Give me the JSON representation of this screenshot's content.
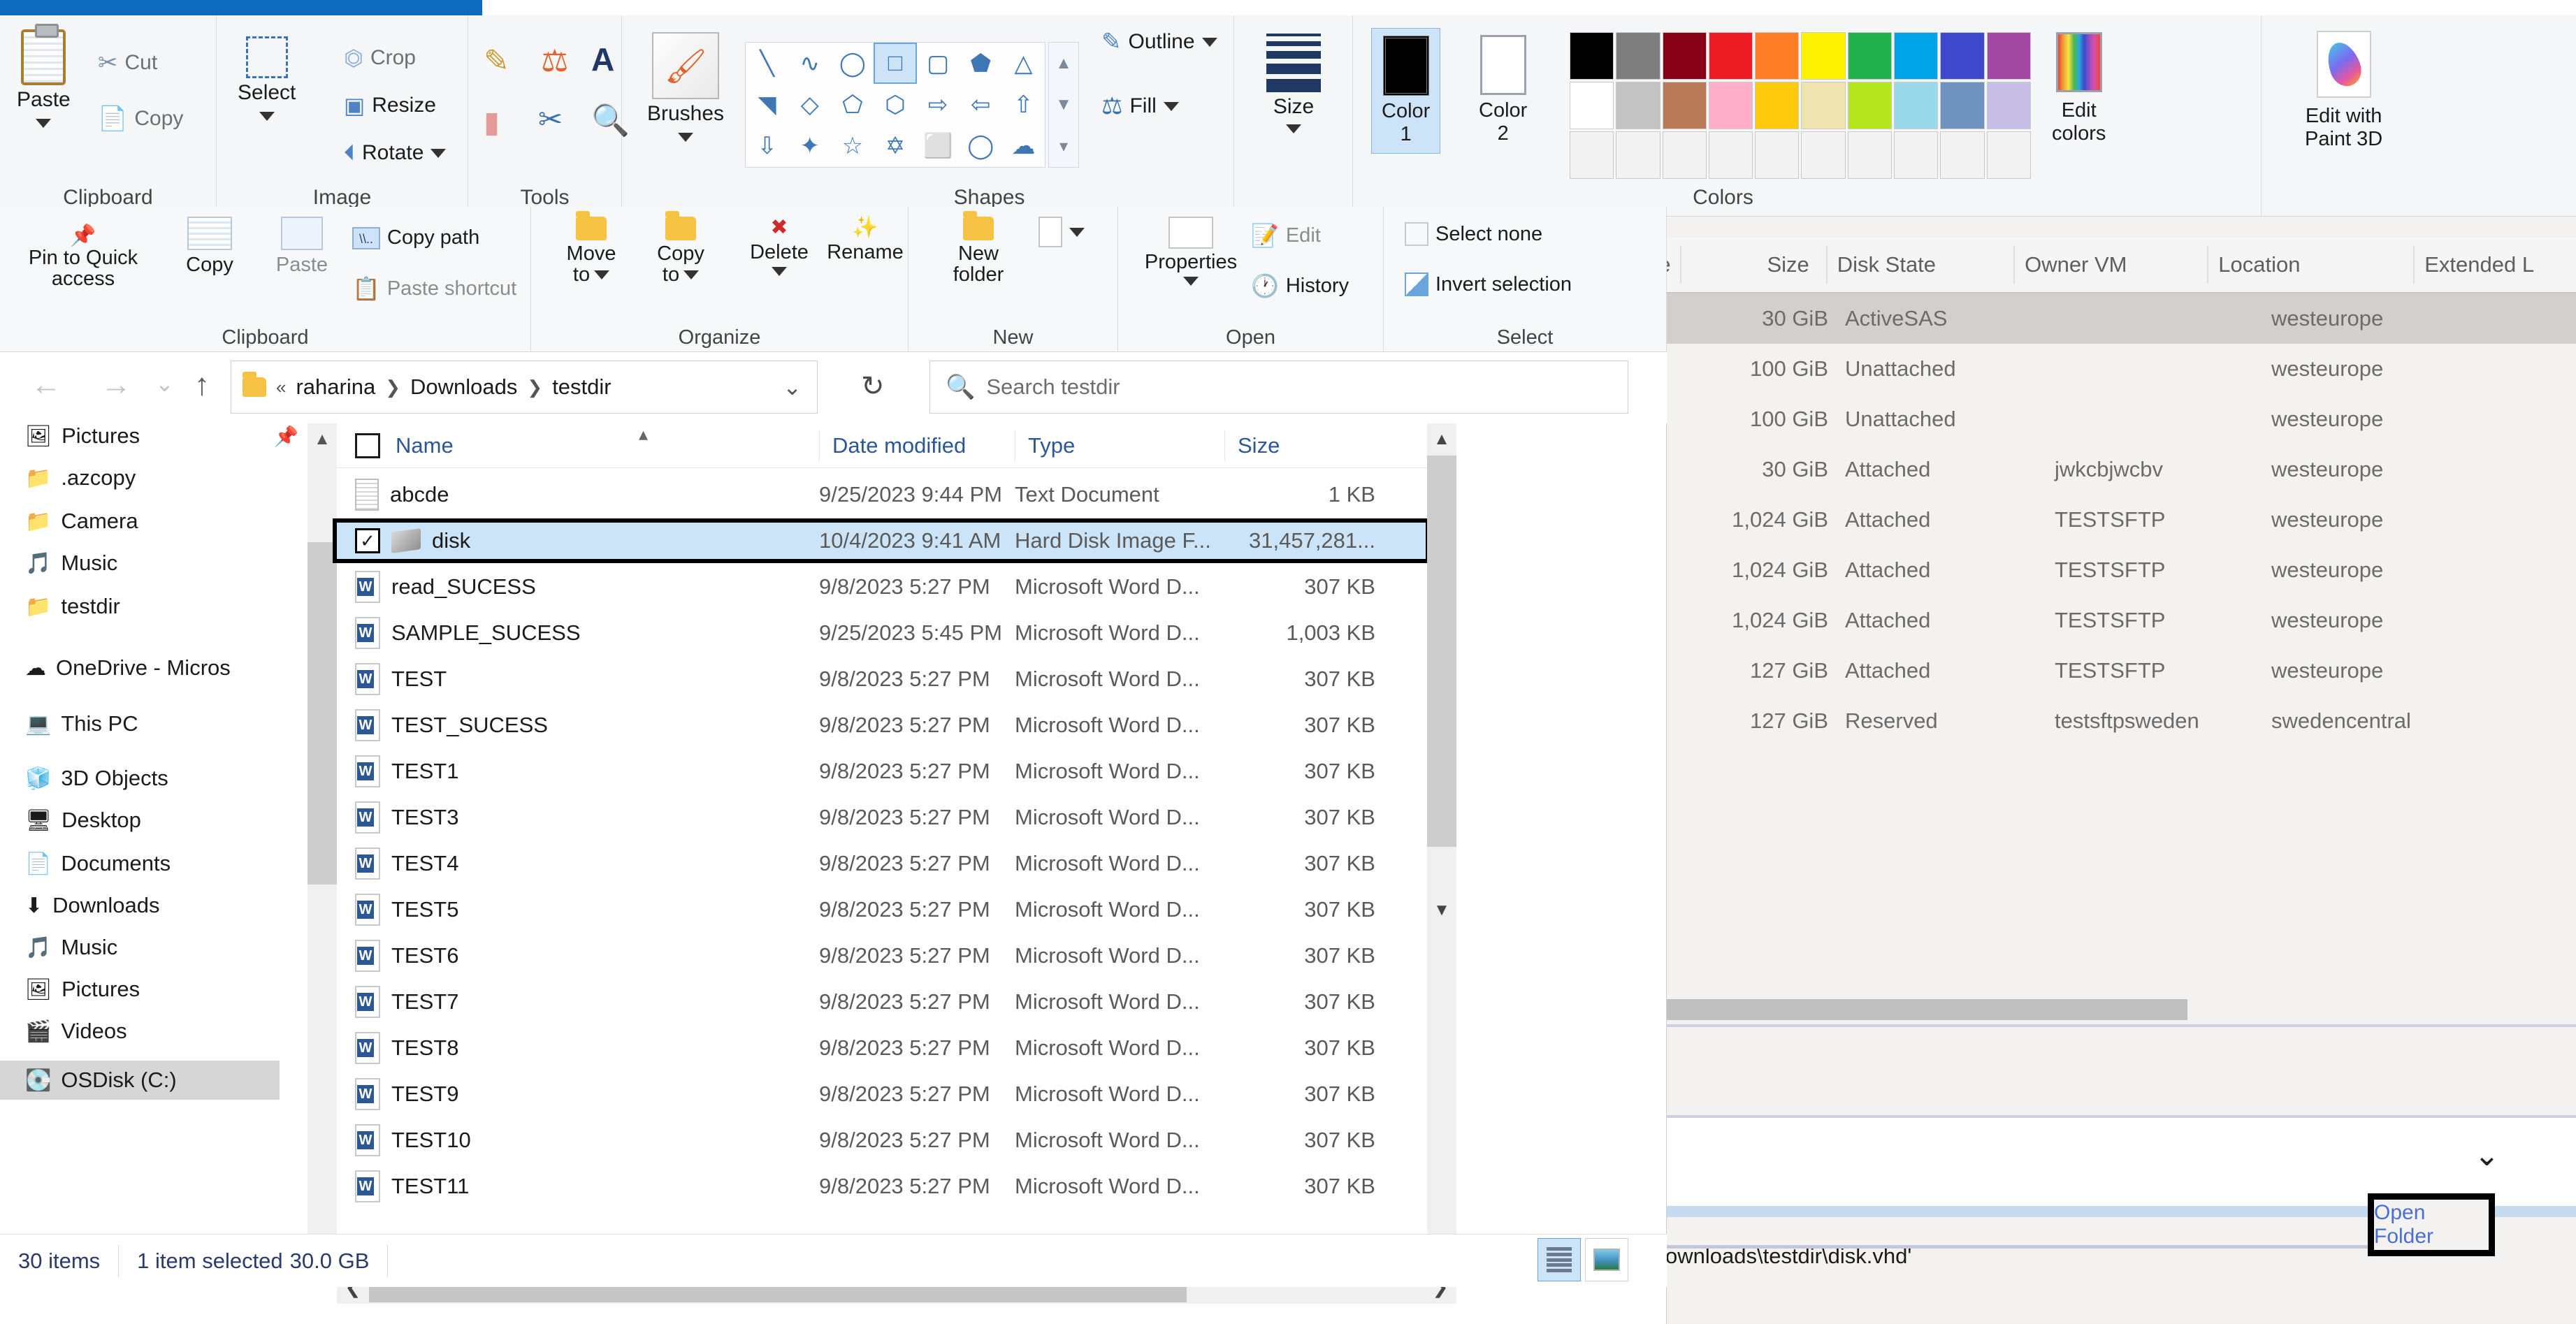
{
  "paint": {
    "groups": {
      "clipboard": {
        "label": "Clipboard",
        "paste": "Paste",
        "cut": "Cut",
        "copy": "Copy"
      },
      "image": {
        "label": "Image",
        "select": "Select",
        "crop": "Crop",
        "resize": "Resize",
        "rotate": "Rotate"
      },
      "tools": {
        "label": "Tools"
      },
      "brushes": {
        "label": "Brushes"
      },
      "shapes": {
        "label": "Shapes",
        "outline": "Outline",
        "fill": "Fill"
      },
      "size": {
        "label": "Size"
      },
      "colors": {
        "label": "Colors",
        "color1": "Color 1",
        "color2": "Color 2",
        "color1_line1": "Color",
        "color1_line2": "1",
        "color2_line1": "Color",
        "color2_line2": "2",
        "edit_colors_l1": "Edit",
        "edit_colors_l2": "colors",
        "paint3d_l1": "Edit with",
        "paint3d_l2": "Paint 3D"
      }
    },
    "palette_row1": [
      "#000000",
      "#7f7f7f",
      "#880015",
      "#ed1c24",
      "#ff7f27",
      "#fff200",
      "#22b14c",
      "#00a2e8",
      "#3f48cc",
      "#a349a4"
    ],
    "palette_row2": [
      "#ffffff",
      "#c3c3c3",
      "#b97a57",
      "#ffaec9",
      "#ffc90e",
      "#efe4b0",
      "#b5e61d",
      "#99d9ea",
      "#7092be",
      "#c8bfe7"
    ],
    "palette_row3": [
      "#f3f3f3",
      "#f3f3f3",
      "#f3f3f3",
      "#f3f3f3",
      "#f3f3f3",
      "#f3f3f3",
      "#f3f3f3",
      "#f3f3f3",
      "#f3f3f3",
      "#f3f3f3"
    ],
    "active_color1": "#000000",
    "active_color2": "#ffffff",
    "shapes": [
      "line",
      "curve",
      "oval",
      "rectangle",
      "rounded-rectangle",
      "polygon",
      "triangle",
      "right-triangle",
      "diamond",
      "pentagon",
      "hexagon",
      "right-arrow",
      "left-arrow",
      "up-arrow",
      "down-arrow",
      "four-point-star",
      "five-point-star",
      "six-point-star",
      "rounded-callout",
      "oval-callout",
      "cloud-callout"
    ],
    "selected_shape": "rectangle"
  },
  "explorer_ribbon": {
    "clipboard": {
      "label": "Clipboard",
      "pin_l1": "Pin to Quick",
      "pin_l2": "access",
      "copy": "Copy",
      "paste": "Paste",
      "copy_path": "Copy path",
      "paste_shortcut": "Paste shortcut"
    },
    "organize": {
      "label": "Organize",
      "move_to_l1": "Move",
      "move_to_l2": "to",
      "copy_to_l1": "Copy",
      "copy_to_l2": "to",
      "delete": "Delete",
      "rename": "Rename"
    },
    "new": {
      "label": "New",
      "new_folder_l1": "New",
      "new_folder_l2": "folder"
    },
    "open": {
      "label": "Open",
      "properties": "Properties",
      "edit": "Edit",
      "history": "History"
    },
    "select": {
      "label": "Select",
      "select_none": "Select none",
      "invert_selection": "Invert selection"
    }
  },
  "explorer": {
    "breadcrumb": [
      "raharina",
      "Downloads",
      "testdir"
    ],
    "breadcrumb_prefix": "«",
    "search_placeholder": "Search testdir",
    "sidebar": [
      {
        "label": "Pictures",
        "icon": "pictures-folder-icon",
        "pinned": true
      },
      {
        "label": ".azcopy",
        "icon": "folder-icon"
      },
      {
        "label": "Camera",
        "icon": "folder-icon"
      },
      {
        "label": "Music",
        "icon": "music-folder-icon"
      },
      {
        "label": "testdir",
        "icon": "folder-icon"
      },
      {
        "label": "OneDrive - Micros",
        "icon": "onedrive-icon"
      },
      {
        "label": "This PC",
        "icon": "this-pc-icon"
      },
      {
        "label": "3D Objects",
        "icon": "3d-objects-folder-icon"
      },
      {
        "label": "Desktop",
        "icon": "desktop-folder-icon"
      },
      {
        "label": "Documents",
        "icon": "documents-folder-icon"
      },
      {
        "label": "Downloads",
        "icon": "downloads-folder-icon"
      },
      {
        "label": "Music",
        "icon": "music-folder-icon"
      },
      {
        "label": "Pictures",
        "icon": "pictures-folder-icon"
      },
      {
        "label": "Videos",
        "icon": "videos-folder-icon"
      },
      {
        "label": "OSDisk (C:)",
        "icon": "drive-icon",
        "selected": true
      }
    ],
    "columns": [
      "Name",
      "Date modified",
      "Type",
      "Size"
    ],
    "files": [
      {
        "name": "abcde",
        "date": "9/25/2023 9:44 PM",
        "type": "Text Document",
        "size": "1 KB",
        "icon": "text-file-icon",
        "selected": false
      },
      {
        "name": "disk",
        "date": "10/4/2023 9:41 AM",
        "type": "Hard Disk Image F...",
        "size": "31,457,281...",
        "icon": "vhd-file-icon",
        "selected": true
      },
      {
        "name": "read_SUCESS",
        "date": "9/8/2023 5:27 PM",
        "type": "Microsoft Word D...",
        "size": "307 KB",
        "icon": "word-file-icon",
        "selected": false
      },
      {
        "name": "SAMPLE_SUCESS",
        "date": "9/25/2023 5:45 PM",
        "type": "Microsoft Word D...",
        "size": "1,003 KB",
        "icon": "word-file-icon",
        "selected": false
      },
      {
        "name": "TEST",
        "date": "9/8/2023 5:27 PM",
        "type": "Microsoft Word D...",
        "size": "307 KB",
        "icon": "word-file-icon",
        "selected": false
      },
      {
        "name": "TEST_SUCESS",
        "date": "9/8/2023 5:27 PM",
        "type": "Microsoft Word D...",
        "size": "307 KB",
        "icon": "word-file-icon",
        "selected": false
      },
      {
        "name": "TEST1",
        "date": "9/8/2023 5:27 PM",
        "type": "Microsoft Word D...",
        "size": "307 KB",
        "icon": "word-file-icon",
        "selected": false
      },
      {
        "name": "TEST3",
        "date": "9/8/2023 5:27 PM",
        "type": "Microsoft Word D...",
        "size": "307 KB",
        "icon": "word-file-icon",
        "selected": false
      },
      {
        "name": "TEST4",
        "date": "9/8/2023 5:27 PM",
        "type": "Microsoft Word D...",
        "size": "307 KB",
        "icon": "word-file-icon",
        "selected": false
      },
      {
        "name": "TEST5",
        "date": "9/8/2023 5:27 PM",
        "type": "Microsoft Word D...",
        "size": "307 KB",
        "icon": "word-file-icon",
        "selected": false
      },
      {
        "name": "TEST6",
        "date": "9/8/2023 5:27 PM",
        "type": "Microsoft Word D...",
        "size": "307 KB",
        "icon": "word-file-icon",
        "selected": false
      },
      {
        "name": "TEST7",
        "date": "9/8/2023 5:27 PM",
        "type": "Microsoft Word D...",
        "size": "307 KB",
        "icon": "word-file-icon",
        "selected": false
      },
      {
        "name": "TEST8",
        "date": "9/8/2023 5:27 PM",
        "type": "Microsoft Word D...",
        "size": "307 KB",
        "icon": "word-file-icon",
        "selected": false
      },
      {
        "name": "TEST9",
        "date": "9/8/2023 5:27 PM",
        "type": "Microsoft Word D...",
        "size": "307 KB",
        "icon": "word-file-icon",
        "selected": false
      },
      {
        "name": "TEST10",
        "date": "9/8/2023 5:27 PM",
        "type": "Microsoft Word D...",
        "size": "307 KB",
        "icon": "word-file-icon",
        "selected": false
      },
      {
        "name": "TEST11",
        "date": "9/8/2023 5:27 PM",
        "type": "Microsoft Word D...",
        "size": "307 KB",
        "icon": "word-file-icon",
        "selected": false
      }
    ],
    "status": {
      "items": "30 items",
      "selected": "1 item selected",
      "size": "30.0 GB"
    }
  },
  "azure": {
    "columns": [
      "pe",
      "Size",
      "Disk State",
      "Owner VM",
      "Location",
      "Extended L"
    ],
    "rows": [
      {
        "size": "30 GiB",
        "state": "ActiveSAS",
        "owner": "",
        "location": "westeurope",
        "highlighted": true
      },
      {
        "size": "100 GiB",
        "state": "Unattached",
        "owner": "",
        "location": "westeurope",
        "highlighted": false
      },
      {
        "size": "100 GiB",
        "state": "Unattached",
        "owner": "",
        "location": "westeurope",
        "highlighted": false
      },
      {
        "size": "30 GiB",
        "state": "Attached",
        "owner": "jwkcbjwcbv",
        "location": "westeurope",
        "highlighted": false
      },
      {
        "size": "1,024 GiB",
        "state": "Attached",
        "owner": "TESTSFTP",
        "location": "westeurope",
        "highlighted": false
      },
      {
        "size": "1,024 GiB",
        "state": "Attached",
        "owner": "TESTSFTP",
        "location": "westeurope",
        "highlighted": false
      },
      {
        "size": "1,024 GiB",
        "state": "Attached",
        "owner": "TESTSFTP",
        "location": "westeurope",
        "highlighted": false
      },
      {
        "size": "127 GiB",
        "state": "Attached",
        "owner": "TESTSFTP",
        "location": "westeurope",
        "highlighted": false
      },
      {
        "size": "127 GiB",
        "state": "Reserved",
        "owner": "testsftpsweden",
        "location": "swedencentral",
        "highlighted": false
      }
    ],
    "path_text": "\\Downloads\\testdir\\disk.vhd'",
    "open_folder_label": "Open Folder"
  }
}
